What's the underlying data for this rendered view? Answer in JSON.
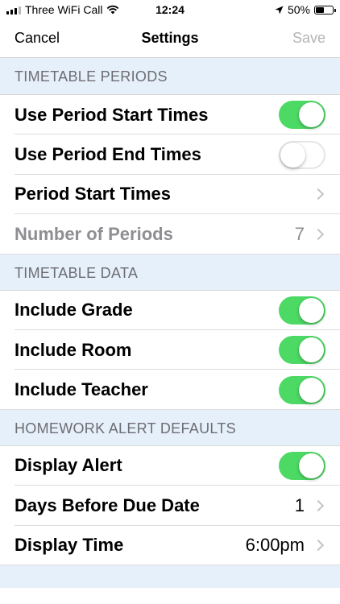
{
  "status_bar": {
    "carrier": "Three WiFi Call",
    "time": "12:24",
    "battery_percent": "50%",
    "battery_level": 0.5,
    "signal_bars_on": 3,
    "signal_bars_total": 4
  },
  "nav": {
    "cancel_label": "Cancel",
    "title": "Settings",
    "save_label": "Save"
  },
  "sections": {
    "periods": {
      "header": "TIMETABLE PERIODS",
      "use_start_times": {
        "label": "Use Period Start Times",
        "on": true
      },
      "use_end_times": {
        "label": "Use Period End Times",
        "on": false
      },
      "start_times": {
        "label": "Period Start Times"
      },
      "num_periods": {
        "label": "Number of Periods",
        "value": "7"
      }
    },
    "data": {
      "header": "TIMETABLE DATA",
      "grade": {
        "label": "Include Grade",
        "on": true
      },
      "room": {
        "label": "Include Room",
        "on": true
      },
      "teacher": {
        "label": "Include Teacher",
        "on": true
      }
    },
    "homework": {
      "header": "HOMEWORK ALERT DEFAULTS",
      "display_alert": {
        "label": "Display Alert",
        "on": true
      },
      "days_before": {
        "label": "Days Before Due Date",
        "value": "1"
      },
      "display_time": {
        "label": "Display Time",
        "value": "6:00pm"
      }
    }
  },
  "colors": {
    "toggle_on": "#4cd964",
    "section_bg": "#e6f0fb",
    "muted_text": "#8e8e93"
  }
}
